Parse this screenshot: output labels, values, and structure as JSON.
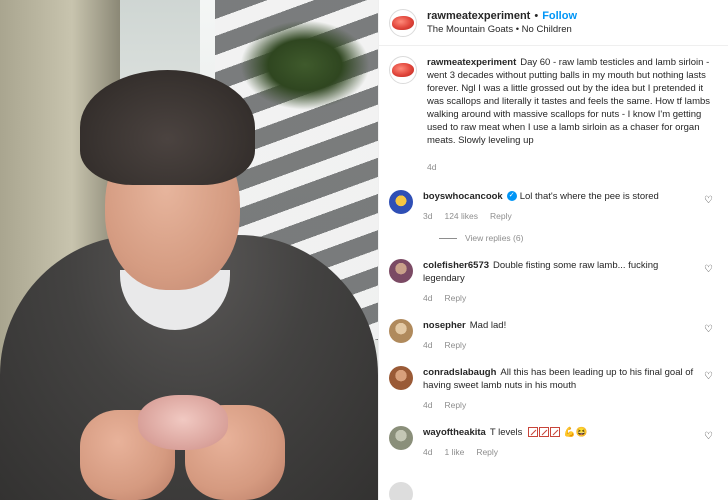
{
  "header": {
    "username": "rawmeatexperiment",
    "separator": "•",
    "follow_label": "Follow",
    "subtitle": "The Mountain Goats • No Children",
    "more_icon": "more-horizontal-icon"
  },
  "caption": {
    "username": "rawmeatexperiment",
    "text": "Day 60 - raw lamb testicles and lamb sirloin - went 3 decades without putting balls in my mouth but nothing lasts forever. Ngl I was a little grossed out by the idea but I pretended it was scallops and literally it tastes and feels the same. How tf lambs walking around with massive scallops for nuts - I know I'm getting used to raw meat when I use a lamb sirloin as a chaser for organ meats. Slowly leveling up",
    "time": "4d"
  },
  "comments": [
    {
      "username": "boyswhocancook",
      "verified": true,
      "text": "Lol that's where the pee is stored",
      "time": "3d",
      "likes": "124 likes",
      "reply_label": "Reply",
      "view_replies": "View replies (6)",
      "avatar_color": "#2f4fb5"
    },
    {
      "username": "colefisher6573",
      "text": "Double fisting some raw lamb... fucking legendary",
      "time": "4d",
      "reply_label": "Reply",
      "avatar_color": "#7b4a64"
    },
    {
      "username": "nosepher",
      "text": "Mad lad!",
      "time": "4d",
      "reply_label": "Reply",
      "avatar_color": "#b08a5c"
    },
    {
      "username": "conradslabaugh",
      "text": "All this has been leading up to his final goal of having sweet lamb nuts in his mouth",
      "time": "4d",
      "reply_label": "Reply",
      "avatar_color": "#9a5a36"
    },
    {
      "username": "wayoftheakita",
      "text": "T levels",
      "time": "4d",
      "likes": "1 like",
      "reply_label": "Reply",
      "emoji_trailing": "💪😆",
      "avatar_color": "#8a8f7a"
    }
  ],
  "icons": {
    "heart": "heart-icon",
    "verified": "verified-badge-icon"
  },
  "colors": {
    "accent": "#0095f6",
    "muted": "#8e8e8e",
    "text": "#262626"
  }
}
